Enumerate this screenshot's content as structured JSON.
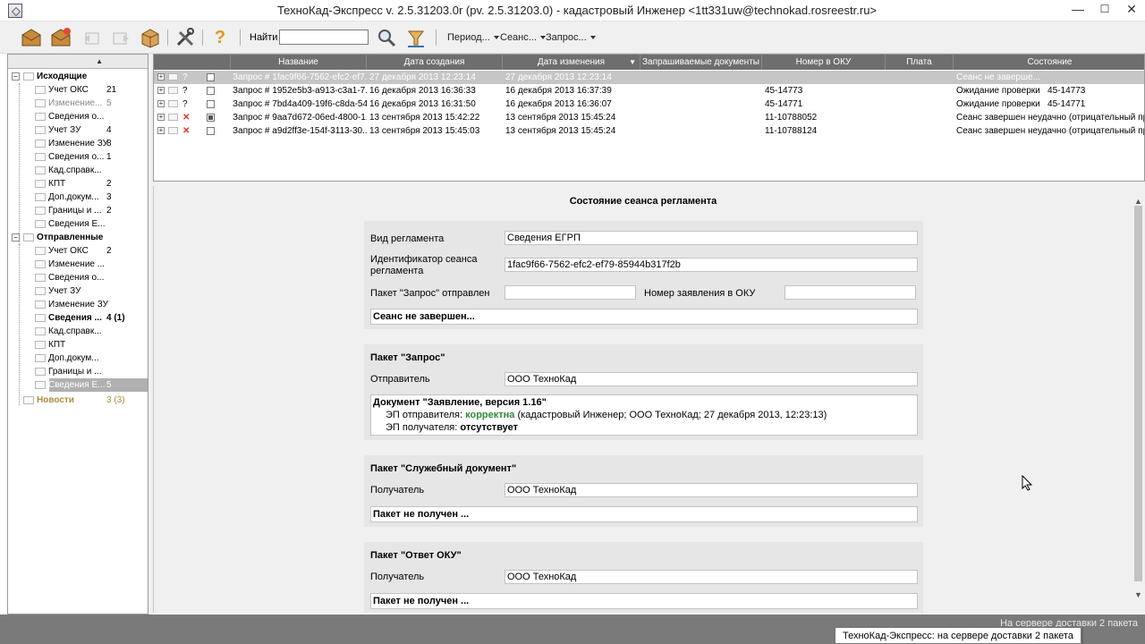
{
  "window": {
    "title": "ТехноКад-Экспресс v. 2.5.31203.0r (pv. 2.5.31203.0) - кадастровый Инженер <1tt331uw@technokad.rosreestr.ru>",
    "minimize": "—",
    "maximize": "☐",
    "close": "✕"
  },
  "toolbar": {
    "find_label": "Найти",
    "find_value": "",
    "period_label": "Период...",
    "session_label": "Сеанс...",
    "request_label": "Запрос...",
    "help_glyph": "?"
  },
  "tree": {
    "collapse_glyph": "▲",
    "groups": [
      {
        "label": "Исходящие",
        "items": [
          {
            "label": "Учет ОКС",
            "count": "21"
          },
          {
            "label": "Изменение...",
            "count": "5"
          },
          {
            "label": "Сведения о...",
            "count": ""
          },
          {
            "label": "Учет ЗУ",
            "count": "4"
          },
          {
            "label": "Изменение ЗУ",
            "count": "8"
          },
          {
            "label": "Сведения о...",
            "count": "1"
          },
          {
            "label": "Кад.справк...",
            "count": ""
          },
          {
            "label": "КПТ",
            "count": "2"
          },
          {
            "label": "Доп.докум...",
            "count": "3"
          },
          {
            "label": "Границы и ...",
            "count": "2"
          },
          {
            "label": "Сведения Е...",
            "count": ""
          }
        ]
      },
      {
        "label": "Отправленные",
        "items": [
          {
            "label": "Учет ОКС",
            "count": "2"
          },
          {
            "label": "Изменение ...",
            "count": ""
          },
          {
            "label": "Сведения о...",
            "count": ""
          },
          {
            "label": "Учет ЗУ",
            "count": ""
          },
          {
            "label": "Изменение ЗУ",
            "count": ""
          },
          {
            "label": "Сведения ...",
            "count": "4 (1)"
          },
          {
            "label": "Кад.справк...",
            "count": ""
          },
          {
            "label": "КПТ",
            "count": ""
          },
          {
            "label": "Доп.докум...",
            "count": ""
          },
          {
            "label": "Границы и ...",
            "count": ""
          },
          {
            "label": "Сведения Е...",
            "count": "5"
          }
        ]
      },
      {
        "label": "Новости",
        "count": "3 (3)"
      }
    ]
  },
  "grid": {
    "columns": [
      "Название",
      "Дата создания",
      "Дата изменения",
      "Запрашиваемые документы",
      "Номер в ОКУ",
      "Плата",
      "Состояние"
    ],
    "sort_glyph": "▼",
    "rows": [
      {
        "status_icon": "?",
        "name": "Запрос # 1fac9f66-7562-efc2-ef7...",
        "created": "27 декабря 2013 12:23:14",
        "modified": "27 декабря 2013 12:23:14",
        "docs": "",
        "oku": "",
        "fee": "",
        "state": "Сеанс не заверше..."
      },
      {
        "status_icon": "?",
        "name": "Запрос # 1952e5b3-a913-c3a1-7...",
        "created": "16 декабря 2013 16:36:33",
        "modified": "16 декабря 2013 16:37:39",
        "docs": "",
        "oku": "45-14773",
        "fee": "",
        "state": "Ожидание проверки   45-14773"
      },
      {
        "status_icon": "?",
        "name": "Запрос # 7bd4a409-19f6-c8da-54...",
        "created": "16 декабря 2013 16:31:50",
        "modified": "16 декабря 2013 16:36:07",
        "docs": "",
        "oku": "45-14771",
        "fee": "",
        "state": "Ожидание проверки   45-14771"
      },
      {
        "status_icon": "✕",
        "name": "Запрос # 9aa7d672-06ed-4800-1...",
        "created": "13 сентября 2013 15:42:22",
        "modified": "13 сентября 2013 15:45:24",
        "docs": "",
        "oku": "11-10788052",
        "fee": "",
        "state": "Сеанс завершен неудачно (отрицательный пр..."
      },
      {
        "status_icon": "✕",
        "name": "Запрос # a9d2ff3e-154f-3113-30...",
        "created": "13 сентября 2013 15:45:03",
        "modified": "13 сентября 2013 15:45:24",
        "docs": "",
        "oku": "11-10788124",
        "fee": "",
        "state": "Сеанс завершен неудачно (отрицательный пр..."
      }
    ]
  },
  "detail": {
    "title": "Состояние сеанса регламента",
    "session": {
      "type_label": "Вид регламента",
      "type_value": "Сведения ЕГРП",
      "id_label_1": "Идентификатор сеанса",
      "id_label_2": "регламента",
      "id_value": "1fac9f66-7562-efc2-ef79-85944b317f2b",
      "sent_label": "Пакет \"Запрос\" отправлен",
      "sent_value": "",
      "app_no_label": "Номер заявления в ОКУ",
      "app_no_value": "",
      "status": "Сеанс не завершен..."
    },
    "request": {
      "title": "Пакет \"Запрос\"",
      "sender_label": "Отправитель",
      "sender_value": "ООО ТехноКад",
      "doc_title": "Документ \"Заявление, версия 1.16\"",
      "sig_sender_label": "ЭП отправителя:",
      "sig_sender_value": "корректна",
      "sig_sender_detail": "(кадастровый Инженер; ООО ТехноКад; 27 декабря 2013, 12:23:13)",
      "sig_receiver_label": "ЭП получателя:",
      "sig_receiver_value": "отсутствует"
    },
    "service": {
      "title": "Пакет \"Служебный документ\"",
      "receiver_label": "Получатель",
      "receiver_value": "ООО ТехноКад",
      "status": "Пакет не получен ..."
    },
    "answer": {
      "title": "Пакет \"Ответ ОКУ\"",
      "receiver_label": "Получатель",
      "receiver_value": "ООО ТехноКад",
      "status": "Пакет не получен ..."
    }
  },
  "statusbar": {
    "text": "На сервере доставки 2 пакета",
    "tooltip": "ТехноКад-Экспресс: на сервере доставки 2 пакета"
  },
  "colors": {
    "grid_header": "#6e6e6e",
    "statusbar": "#7a7a7a",
    "valid_signature": "#2e8b3a",
    "news": "#b08a3c"
  }
}
